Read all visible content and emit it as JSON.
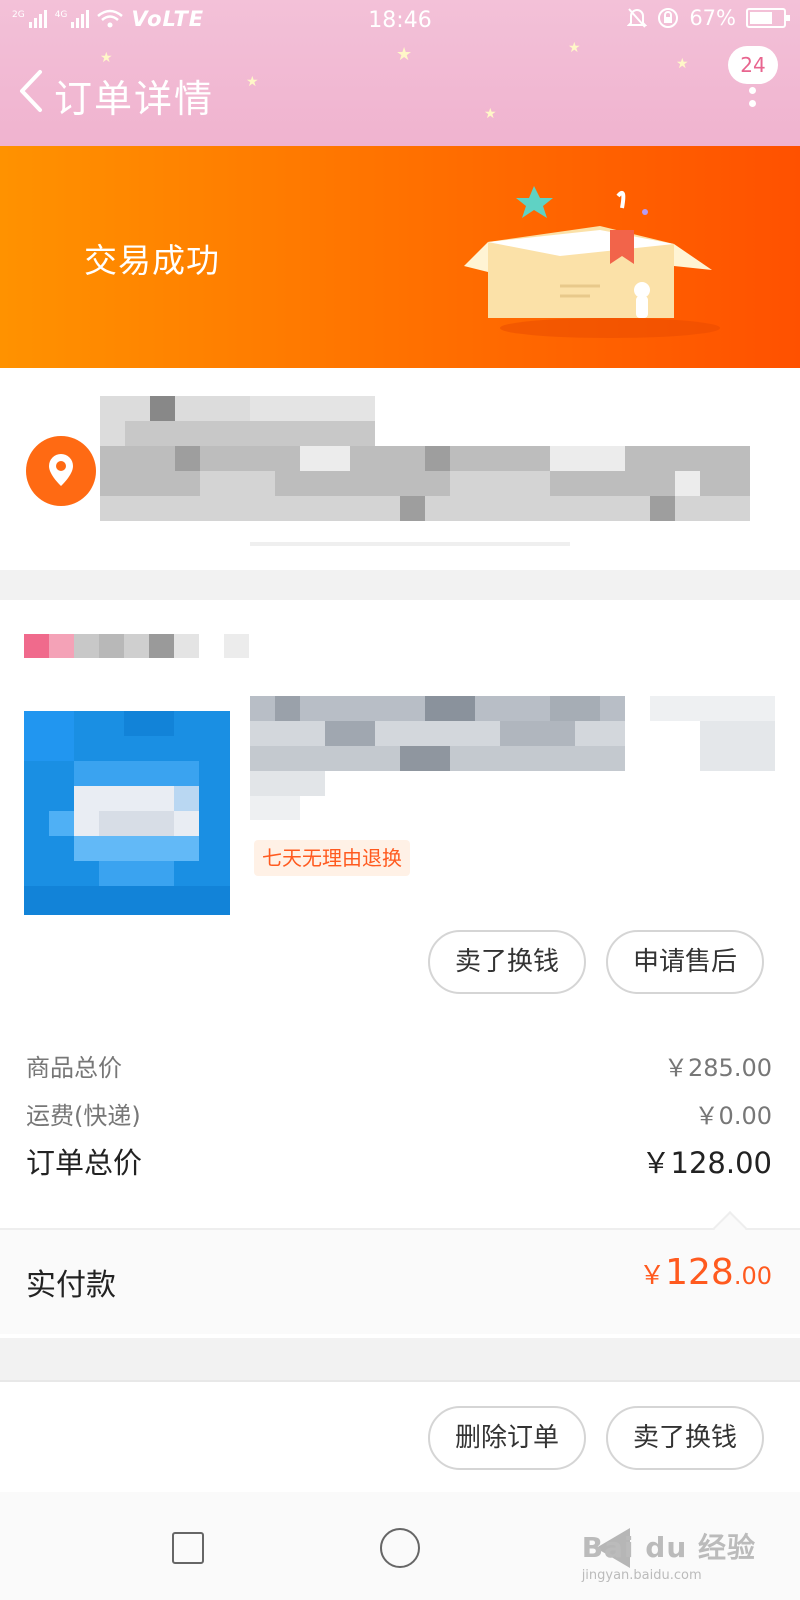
{
  "status_bar": {
    "network": "VoLTE",
    "sig1": "2G",
    "sig2": "4G",
    "time": "18:46",
    "battery": "67%"
  },
  "header": {
    "title": "订单详情",
    "badge": "24"
  },
  "banner": {
    "status": "交易成功"
  },
  "order": {
    "tag": "七天无理由退换",
    "item_buttons": [
      "卖了换钱",
      "申请售后"
    ],
    "rows": [
      {
        "label": "商品总价",
        "value": "￥285.00"
      },
      {
        "label": "运费(快递)",
        "value": "￥0.00"
      },
      {
        "label": "订单总价",
        "value": "￥128.00"
      }
    ],
    "paid": {
      "label": "实付款",
      "currency": "￥",
      "integer": "128",
      "decimal": ".00"
    }
  },
  "footer_buttons": [
    "删除订单",
    "卖了换钱"
  ],
  "watermark": {
    "main": "Bai du 经验",
    "sub": "jingyan.baidu.com"
  },
  "colors": {
    "accent": "#ff5a1f",
    "header": "#f0b3cf",
    "banner": "#ff6e00"
  }
}
